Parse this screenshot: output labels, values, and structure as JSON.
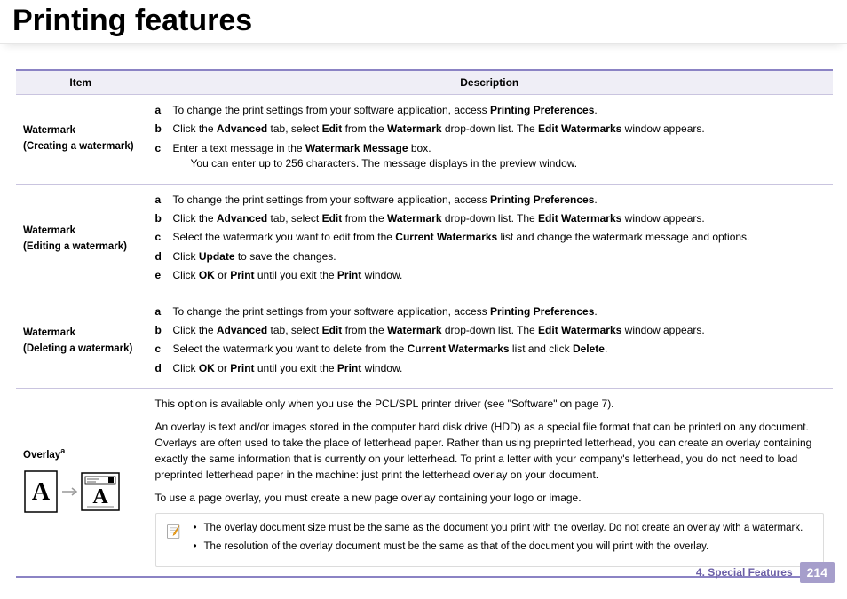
{
  "title": "Printing features",
  "headers": {
    "item": "Item",
    "desc": "Description"
  },
  "rows": {
    "r1": {
      "title": "Watermark",
      "subtitle": "(Creating a watermark)",
      "a_pre": "To change the print settings from your software application, access ",
      "a_b1": "Printing Preferences",
      "a_post": ".",
      "b_p1": "Click the ",
      "b_b1": "Advanced",
      "b_p2": " tab, select ",
      "b_b2": "Edit",
      "b_p3": " from the ",
      "b_b3": "Watermark",
      "b_p4": " drop-down list. The ",
      "b_b4": "Edit Watermarks",
      "b_p5": " window appears.",
      "c_p1": "Enter a text message in the ",
      "c_b1": "Watermark Message",
      "c_p2": " box.",
      "c_indent": "You can enter up to 256 characters. The message displays in the preview window."
    },
    "r2": {
      "title": "Watermark",
      "subtitle": "(Editing a watermark)",
      "a_pre": "To change the print settings from your software application, access ",
      "a_b1": "Printing Preferences",
      "a_post": ".",
      "b_p1": "Click the ",
      "b_b1": "Advanced",
      "b_p2": " tab, select ",
      "b_b2": "Edit",
      "b_p3": " from the ",
      "b_b3": "Watermark",
      "b_p4": " drop-down list. The ",
      "b_b4": "Edit Watermarks",
      "b_p5": " window appears.",
      "c_p1": "Select the watermark you want to edit from the ",
      "c_b1": "Current Watermarks",
      "c_p2": " list and change the watermark message and options.",
      "d_p1": "Click ",
      "d_b1": "Update",
      "d_p2": " to save the changes.",
      "e_p1": "Click ",
      "e_b1": "OK",
      "e_p2": " or ",
      "e_b2": "Print",
      "e_p3": " until you exit the ",
      "e_b3": "Print",
      "e_p4": " window."
    },
    "r3": {
      "title": "Watermark",
      "subtitle": "(Deleting a watermark)",
      "a_pre": "To change the print settings from your software application, access ",
      "a_b1": "Printing Preferences",
      "a_post": ".",
      "b_p1": "Click the ",
      "b_b1": "Advanced",
      "b_p2": " tab, select ",
      "b_b2": "Edit",
      "b_p3": " from the ",
      "b_b3": "Watermark",
      "b_p4": " drop-down list. The ",
      "b_b4": "Edit Watermarks",
      "b_p5": " window appears.",
      "c_p1": "Select the watermark you want to delete from the ",
      "c_b1": "Current Watermarks",
      "c_p2": " list and click ",
      "c_b2": "Delete",
      "c_p3": ".",
      "d_p1": "Click ",
      "d_b1": "OK",
      "d_p2": " or ",
      "d_b2": "Print",
      "d_p3": " until you exit the ",
      "d_b3": "Print",
      "d_p4": " window."
    },
    "r4": {
      "title_pre": "Overlay",
      "title_sup": "a",
      "p1": "This option is available only when you use the PCL/SPL printer driver (see \"Software\" on page 7).",
      "p2": "An overlay is text and/or images stored in the computer hard disk drive (HDD) as a special file format that can be printed on any document. Overlays are often used to take the place of letterhead paper. Rather than using preprinted letterhead, you can create an overlay containing exactly the same information that is currently on your letterhead. To print a letter with your company's letterhead, you do not need to load preprinted letterhead paper in the machine: just print the letterhead overlay on your document.",
      "p3": "To use a page overlay, you must create a new page overlay containing your logo or image.",
      "note1": "The overlay document size must be the same as the document you print with the overlay. Do not create an overlay with a watermark.",
      "note2": "The resolution of the overlay document must be the same as that of the document you will print with the overlay."
    }
  },
  "figLetter": "A",
  "footer": {
    "chapter": "4.  Special Features",
    "page": "214"
  }
}
